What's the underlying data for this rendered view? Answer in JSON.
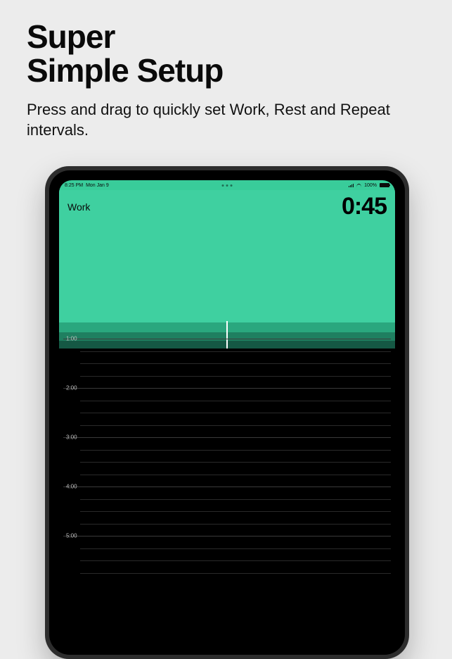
{
  "marketing": {
    "headline_l1": "Super",
    "headline_l2": "Simple Setup",
    "subhead": "Press and drag to quickly set Work, Rest and Repeat intervals."
  },
  "status_bar": {
    "time": "8:25 PM",
    "date": "Mon Jan 9",
    "battery_pct": "100%"
  },
  "timer": {
    "mode_label": "Work",
    "value": "0:45"
  },
  "timeline": {
    "major_ticks": [
      "1:00",
      "2:00",
      "3:00",
      "4:00",
      "5:00"
    ]
  },
  "colors": {
    "accent": "#3fd0a0",
    "band1": "#2aa77e",
    "band2": "#1f7f60",
    "band3": "#155844"
  }
}
